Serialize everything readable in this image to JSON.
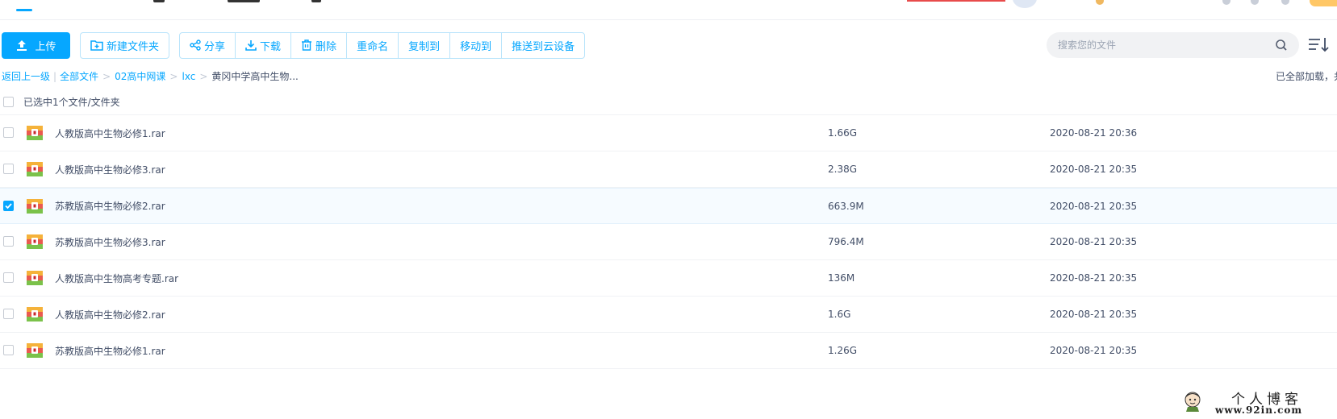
{
  "toolbar": {
    "upload_label": "上传",
    "new_folder_label": "新建文件夹",
    "share_label": "分享",
    "download_label": "下载",
    "delete_label": "删除",
    "rename_label": "重命名",
    "copy_to_label": "复制到",
    "move_to_label": "移动到",
    "push_label": "推送到云设备"
  },
  "search": {
    "placeholder": "搜索您的文件",
    "value": ""
  },
  "breadcrumb": {
    "back_label": "返回上一级",
    "all_files_label": "全部文件",
    "sep": ">",
    "crumbs": [
      "02高中网课",
      "lxc"
    ],
    "current": "黄冈中学高中生物..."
  },
  "status": {
    "loaded_text": "已全部加载，共"
  },
  "selection": {
    "text": "已选中1个文件/文件夹"
  },
  "files": [
    {
      "name": "人教版高中生物必修1.rar",
      "size": "1.66G",
      "date": "2020-08-21 20:36",
      "selected": false
    },
    {
      "name": "人教版高中生物必修3.rar",
      "size": "2.38G",
      "date": "2020-08-21 20:35",
      "selected": false
    },
    {
      "name": "苏教版高中生物必修2.rar",
      "size": "663.9M",
      "date": "2020-08-21 20:35",
      "selected": true
    },
    {
      "name": "苏教版高中生物必修3.rar",
      "size": "796.4M",
      "date": "2020-08-21 20:35",
      "selected": false
    },
    {
      "name": "人教版高中生物高考专题.rar",
      "size": "136M",
      "date": "2020-08-21 20:35",
      "selected": false
    },
    {
      "name": "人教版高中生物必修2.rar",
      "size": "1.6G",
      "date": "2020-08-21 20:35",
      "selected": false
    },
    {
      "name": "苏教版高中生物必修1.rar",
      "size": "1.26G",
      "date": "2020-08-21 20:35",
      "selected": false
    }
  ],
  "watermark": {
    "title": "个人博客",
    "url": "www.92in.com"
  },
  "colors": {
    "accent": "#06a7ff",
    "text": "#424e67",
    "selected_row": "#f6fbff"
  },
  "icons": {
    "upload": "upload-icon",
    "new_folder": "folder-plus-icon",
    "share": "share-icon",
    "download": "download-icon",
    "delete": "trash-icon",
    "search": "search-icon",
    "sort": "sort-icon",
    "file": "rar-archive-icon"
  }
}
